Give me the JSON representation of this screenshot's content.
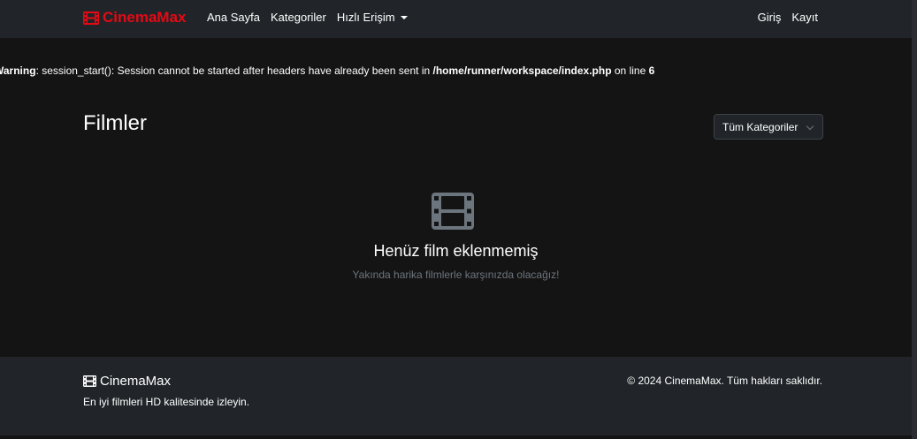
{
  "navbar": {
    "brand": "CinemaMax",
    "links": [
      "Ana Sayfa",
      "Kategoriler",
      "Hızlı Erişim"
    ],
    "login": "Giriş",
    "register": "Kayıt"
  },
  "warning": {
    "label": "Warning",
    "message": ": session_start(): Session cannot be started after headers have already been sent in ",
    "path": "/home/runner/workspace/index.php",
    "on_line": " on line ",
    "line": "6"
  },
  "main": {
    "title": "Filmler",
    "category_select": "Tüm Kategoriler",
    "empty_title": "Henüz film eklenmemiş",
    "empty_subtitle": "Yakında harika filmlerle karşınızda olacağız!"
  },
  "footer": {
    "brand": "CinemaMax",
    "tagline": "En iyi filmleri HD kalitesinde izleyin.",
    "copyright": "© 2024 CinemaMax. Tüm hakları saklıdır."
  },
  "colors": {
    "brand": "#e50914",
    "navbar_bg": "#212529",
    "page_bg": "#141414",
    "muted": "#6c757d"
  },
  "icons": {
    "brand": "film-icon",
    "empty": "film-icon",
    "footer": "film-icon",
    "dropdown": "caret-down-icon"
  }
}
